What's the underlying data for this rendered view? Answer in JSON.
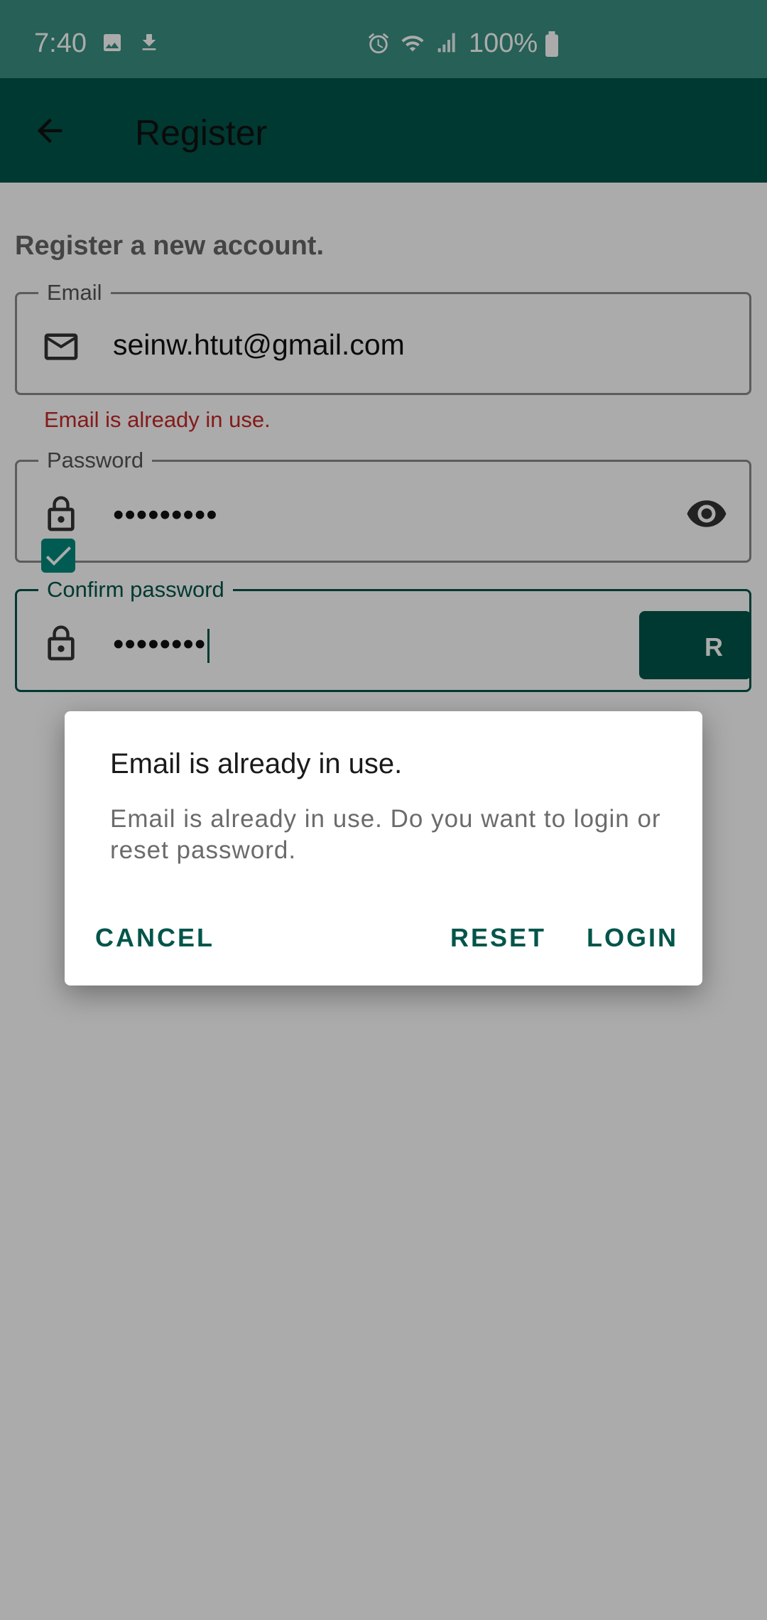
{
  "status_bar": {
    "time": "7:40",
    "battery": "100%",
    "icons": [
      "image-icon",
      "download-icon",
      "alarm-icon",
      "wifi-icon",
      "signal-icon",
      "battery-icon"
    ]
  },
  "app_bar": {
    "title": "Register",
    "back_icon": "arrow-back-icon"
  },
  "form": {
    "heading": "Register a new account.",
    "email": {
      "label": "Email",
      "value": "seinw.htut@gmail.com",
      "error": "Email is already in use."
    },
    "password": {
      "label": "Password",
      "value": "•••••••••"
    },
    "confirm_password": {
      "label": "Confirm password",
      "value": "••••••••"
    },
    "checkbox_checked": true,
    "register_button_visible_text": "R"
  },
  "dialog": {
    "title": "Email is already in use.",
    "message": "Email is already in use. Do you want to login or reset password.",
    "cancel_label": "CANCEL",
    "reset_label": "RESET",
    "login_label": "LOGIN"
  },
  "colors": {
    "status_bar": "#3a8f80",
    "app_bar": "#00554a",
    "accent": "#00554a",
    "error": "#c62828",
    "checkbox": "#00897b"
  }
}
